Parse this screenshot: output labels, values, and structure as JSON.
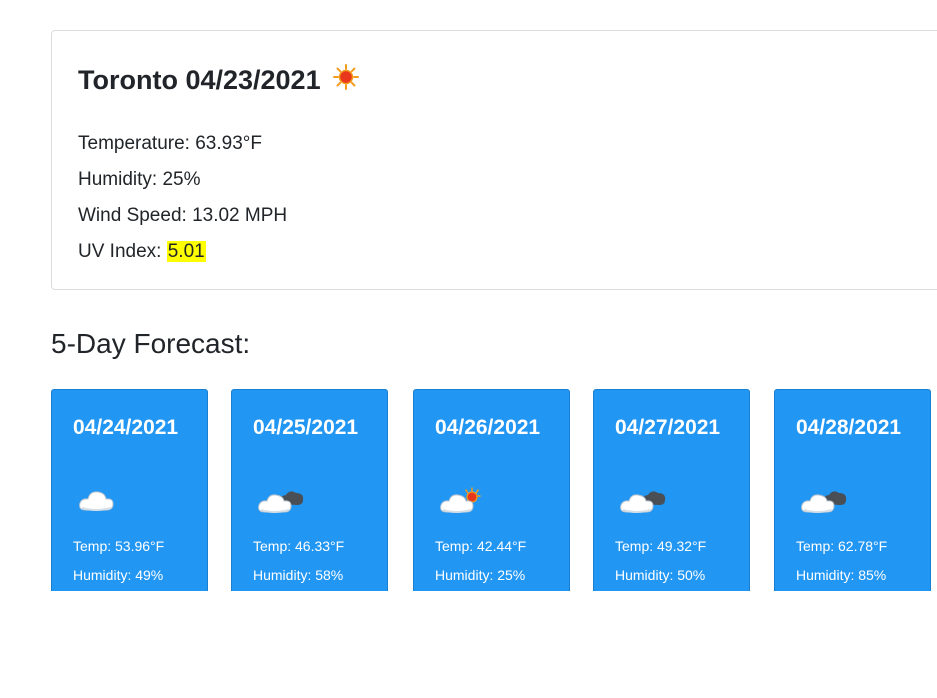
{
  "current": {
    "title": "Toronto 04/23/2021",
    "icon": "sun-icon",
    "temperature": "Temperature: 63.93°F",
    "humidity": "Humidity: 25%",
    "wind": "Wind Speed: 13.02 MPH",
    "uv_label": "UV Index: ",
    "uv_value": "5.01",
    "uv_color": "#ffff00"
  },
  "forecast": {
    "heading": "5-Day Forecast:",
    "card_color": "#2196f3",
    "days": [
      {
        "date": "04/24/2021",
        "icon": "cloud-icon",
        "temp": "Temp: 53.96°F",
        "humidity": "Humidity: 49%"
      },
      {
        "date": "04/25/2021",
        "icon": "clouds-icon",
        "temp": "Temp: 46.33°F",
        "humidity": "Humidity: 58%"
      },
      {
        "date": "04/26/2021",
        "icon": "sun-cloud-icon",
        "temp": "Temp: 42.44°F",
        "humidity": "Humidity: 25%"
      },
      {
        "date": "04/27/2021",
        "icon": "clouds-icon",
        "temp": "Temp: 49.32°F",
        "humidity": "Humidity: 50%"
      },
      {
        "date": "04/28/2021",
        "icon": "clouds-icon",
        "temp": "Temp: 62.78°F",
        "humidity": "Humidity: 85%"
      }
    ]
  }
}
